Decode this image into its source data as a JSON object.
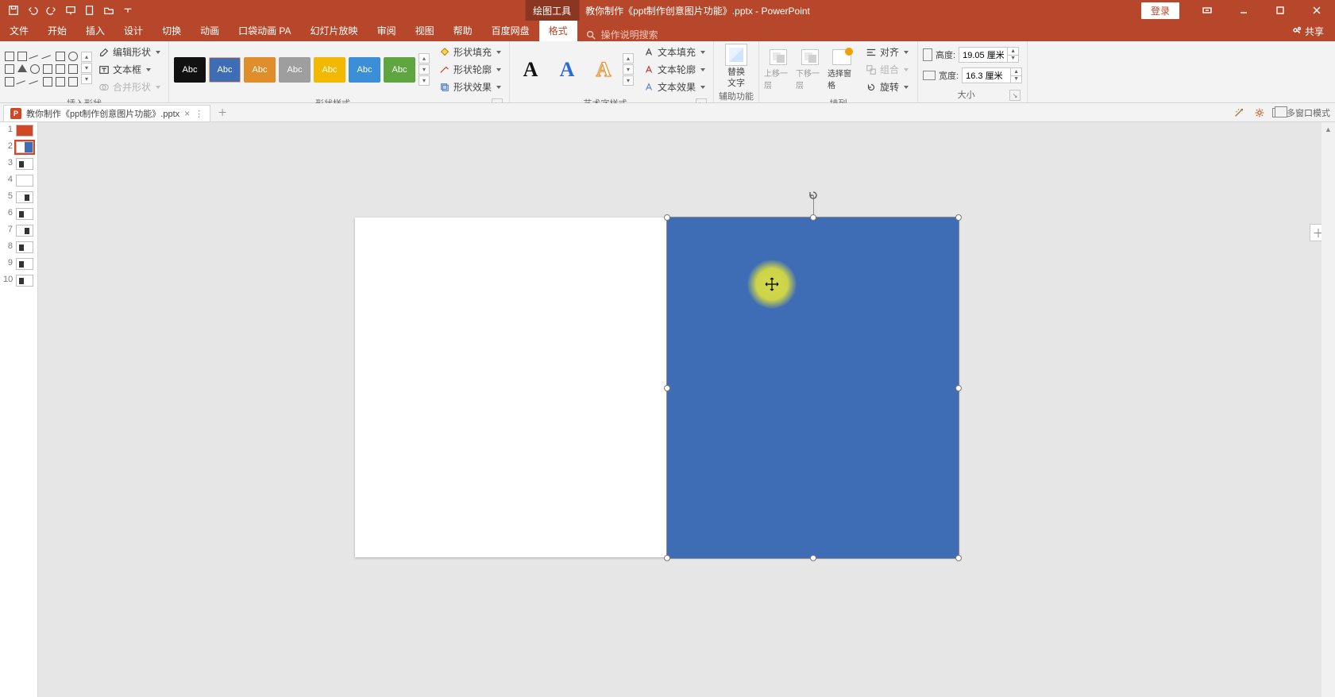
{
  "title": {
    "context_tab": "绘图工具",
    "doc": "教你制作《ppt制作创意图片功能》.pptx",
    "app": "PowerPoint"
  },
  "qat_icons": [
    "save-icon",
    "undo-icon",
    "redo-icon",
    "present-icon",
    "new-icon",
    "open-icon",
    "more-icon"
  ],
  "win": {
    "login": "登录"
  },
  "tabs": {
    "items": [
      "文件",
      "开始",
      "插入",
      "设计",
      "切换",
      "动画",
      "口袋动画 PA",
      "幻灯片放映",
      "审阅",
      "视图",
      "帮助",
      "百度网盘",
      "格式"
    ],
    "active_index": 12,
    "tell_me": "操作说明搜索"
  },
  "share_label": "共享",
  "ribbon": {
    "groups": {
      "insert_shape": {
        "label": "插入形状",
        "edit_shape": "编辑形状",
        "text_box": "文本框",
        "merge": "合并形状"
      },
      "shape_style": {
        "label": "形状样式",
        "swatch_text": "Abc",
        "colors": [
          "#111111",
          "#3e6db5",
          "#e08e2b",
          "#9e9e9e",
          "#f2b900",
          "#3a8fd6",
          "#5fa641"
        ],
        "sel_index": 1,
        "fill": "形状填充",
        "outline": "形状轮廓",
        "effects": "形状效果"
      },
      "wordart": {
        "label": "艺术字样式",
        "wa_colors": [
          "#111111",
          "#2a6bd4",
          "#e08e2b"
        ],
        "text_fill": "文本填充",
        "text_outline": "文本轮廓",
        "text_effects": "文本效果"
      },
      "accessibility": {
        "label": "辅助功能",
        "alt_text_l1": "替换",
        "alt_text_l2": "文字"
      },
      "arrange": {
        "label": "排列",
        "bring_fwd": "上移一层",
        "send_back": "下移一层",
        "sel_pane": "选择窗格",
        "align": "对齐",
        "group": "组合",
        "rotate": "旋转"
      },
      "size": {
        "label": "大小",
        "height_label": "高度:",
        "width_label": "宽度:",
        "height_value": "19.05 厘米",
        "width_value": "16.3 厘米"
      }
    }
  },
  "doc_tab": {
    "name": "教你制作《ppt制作创意图片功能》.pptx"
  },
  "right_tools": {
    "multiwin": "多窗口模式"
  },
  "slides": [
    {
      "n": 1,
      "cls": "red"
    },
    {
      "n": 2,
      "cls": "half",
      "sel": true
    },
    {
      "n": 3,
      "cls": "dark"
    },
    {
      "n": 4,
      "cls": ""
    },
    {
      "n": 5,
      "cls": "dark2"
    },
    {
      "n": 6,
      "cls": "dark"
    },
    {
      "n": 7,
      "cls": "dark2"
    },
    {
      "n": 8,
      "cls": "dark"
    },
    {
      "n": 9,
      "cls": "dark"
    },
    {
      "n": 10,
      "cls": "dark"
    }
  ],
  "shape": {
    "fill": "#3e6db5"
  }
}
